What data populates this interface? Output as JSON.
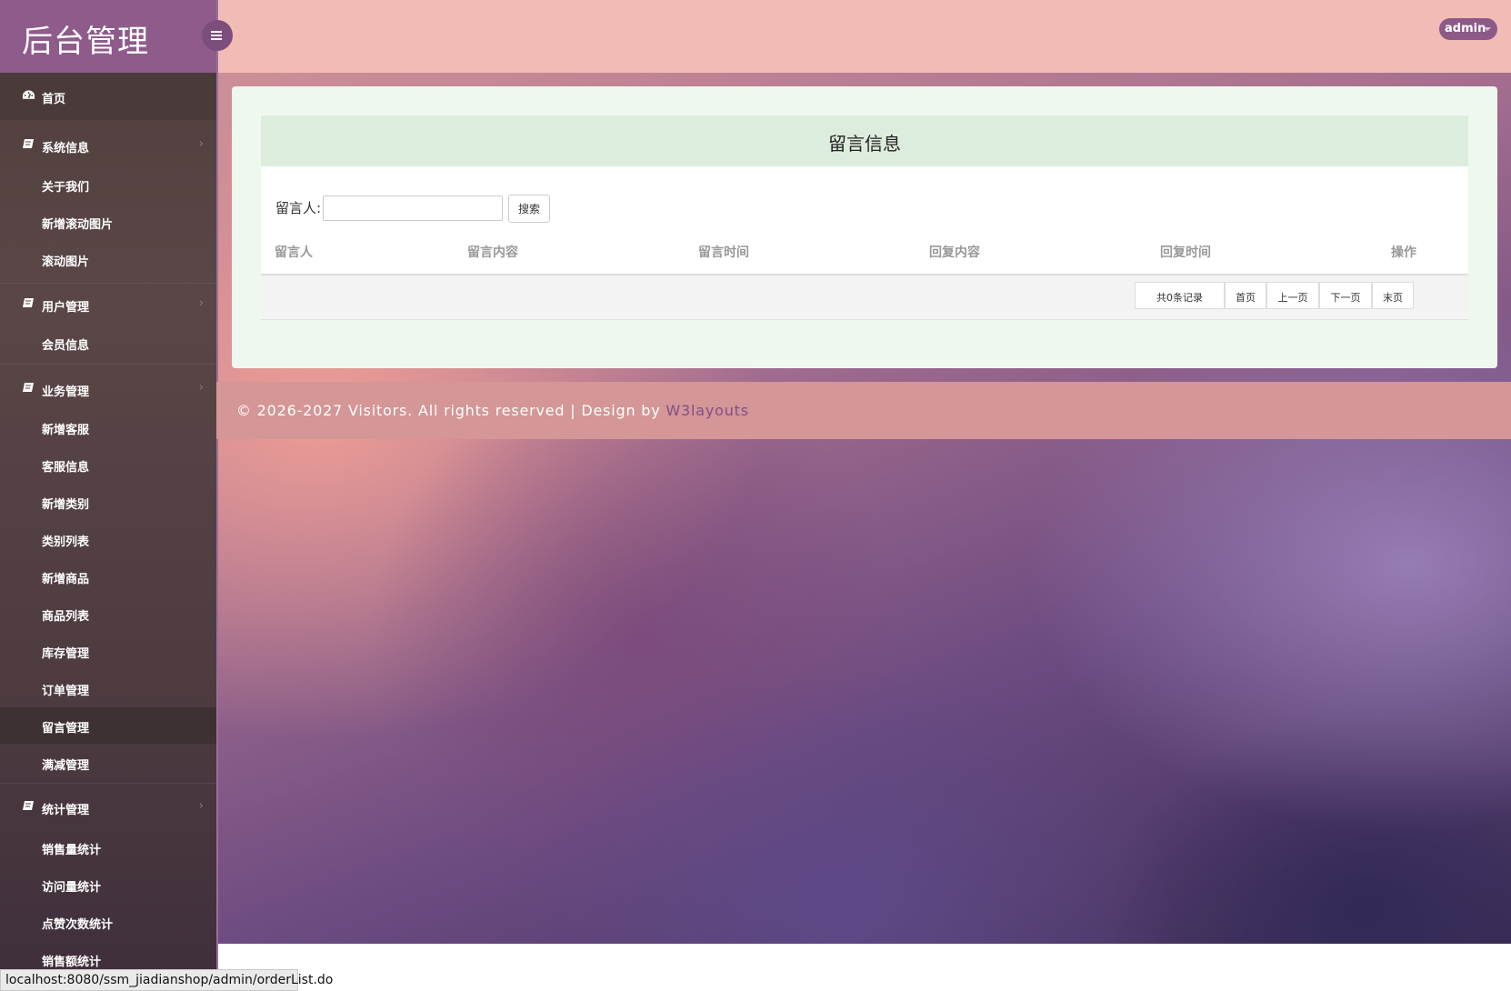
{
  "brand": {
    "title": "后台管理"
  },
  "header": {
    "user_label": "admin"
  },
  "sidebar": {
    "home": "首页",
    "groups": [
      {
        "label": "系统信息",
        "items": [
          "关于我们",
          "新增滚动图片",
          "滚动图片"
        ]
      },
      {
        "label": "用户管理",
        "items": [
          "会员信息"
        ]
      },
      {
        "label": "业务管理",
        "items": [
          "新增客服",
          "客服信息",
          "新增类别",
          "类别列表",
          "新增商品",
          "商品列表",
          "库存管理",
          "订单管理",
          "留言管理",
          "满减管理"
        ]
      },
      {
        "label": "统计管理",
        "items": [
          "销售量统计",
          "访问量统计",
          "点赞次数统计",
          "销售额统计"
        ]
      }
    ],
    "active_item": "留言管理",
    "colors": {
      "brand_bg": "#8e5b8b",
      "sidebar_bg": "#4f3f3e",
      "active_bg": "#3e3132"
    }
  },
  "panel": {
    "title": "留言信息",
    "search": {
      "label": "留言人:",
      "value": "",
      "button": "搜索"
    },
    "table": {
      "columns": [
        "留言人",
        "留言内容",
        "留言时间",
        "回复内容",
        "回复时间",
        "操作"
      ],
      "rows": []
    },
    "pagination": {
      "total_label": "共0条记录",
      "first": "首页",
      "prev": "上一页",
      "next": "下一页",
      "last": "末页"
    }
  },
  "footer": {
    "text": "© 2026-2027 Visitors. All rights reserved | Design by ",
    "link": "W3layouts"
  },
  "status_bar": {
    "url": "localhost:8080/ssm_jiadianshop/admin/orderList.do"
  }
}
